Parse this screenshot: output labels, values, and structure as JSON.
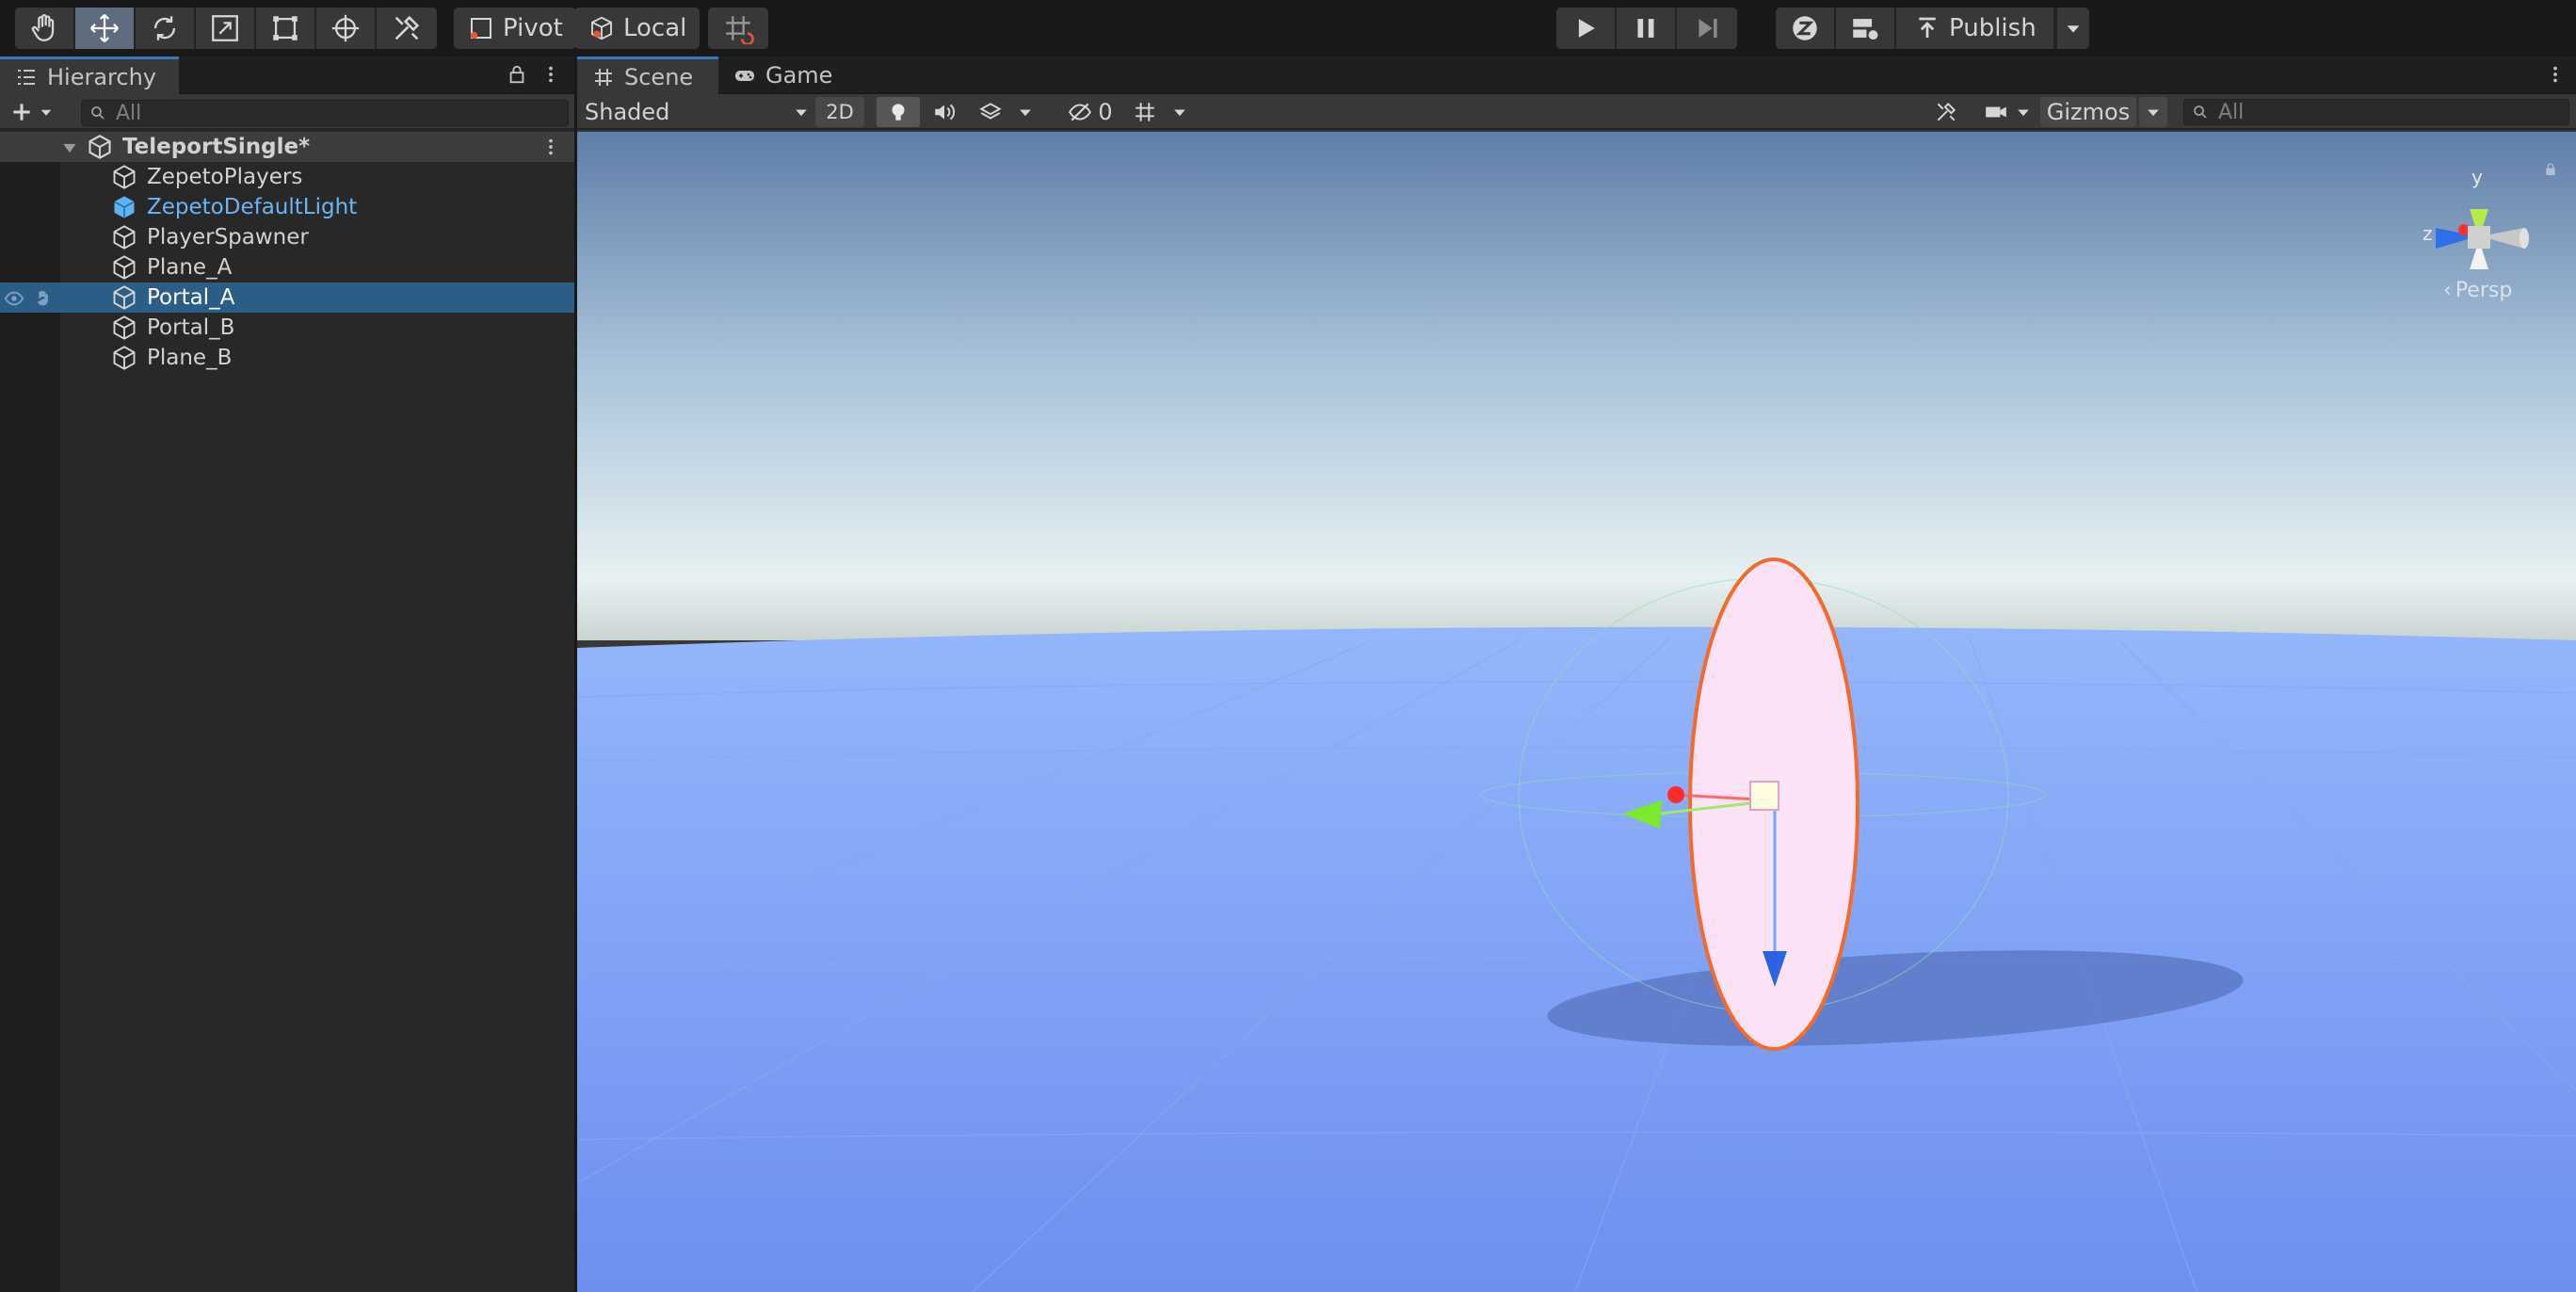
{
  "toolbar": {
    "tools": [
      {
        "name": "hand-tool",
        "icon": "hand-icon",
        "active": false
      },
      {
        "name": "move-tool",
        "icon": "move-icon",
        "active": true
      },
      {
        "name": "rotate-tool",
        "icon": "rotate-icon",
        "active": false
      },
      {
        "name": "scale-tool",
        "icon": "scale-icon",
        "active": false
      },
      {
        "name": "rect-tool",
        "icon": "rect-icon",
        "active": false
      },
      {
        "name": "transform-tool",
        "icon": "transform-icon",
        "active": false
      },
      {
        "name": "custom-tool",
        "icon": "tools-icon",
        "active": false
      }
    ],
    "pivot_label": "Pivot",
    "local_label": "Local",
    "publish_label": "Publish"
  },
  "hierarchy": {
    "tab_label": "Hierarchy",
    "search_placeholder": "All",
    "scene_name": "TeleportSingle*",
    "items": [
      {
        "label": "ZepetoPlayers",
        "prefab": false,
        "selected": false
      },
      {
        "label": "ZepetoDefaultLight",
        "prefab": true,
        "selected": false
      },
      {
        "label": "PlayerSpawner",
        "prefab": false,
        "selected": false
      },
      {
        "label": "Plane_A",
        "prefab": false,
        "selected": false
      },
      {
        "label": "Portal_A",
        "prefab": false,
        "selected": true
      },
      {
        "label": "Portal_B",
        "prefab": false,
        "selected": false
      },
      {
        "label": "Plane_B",
        "prefab": false,
        "selected": false
      }
    ]
  },
  "scene": {
    "tabs": [
      {
        "label": "Scene",
        "icon": "grid-icon",
        "selected": true
      },
      {
        "label": "Game",
        "icon": "gamepad-icon",
        "selected": false
      }
    ],
    "shading_mode": "Shaded",
    "mode_2d": "2D",
    "hidden_count": "0",
    "gizmos_label": "Gizmos",
    "search_placeholder": "All",
    "gizmo_axes": {
      "y": "y",
      "z": "z"
    },
    "projection": "Persp"
  },
  "colors": {
    "accent": "#3a79bb",
    "selection": "#2c5d87",
    "prefab_text": "#6cb5f5",
    "sky_top": "#5f7ea8",
    "ground": "#7c9ef0",
    "portal_fill": "#fbe2f6",
    "portal_outline": "#f36a2a"
  }
}
